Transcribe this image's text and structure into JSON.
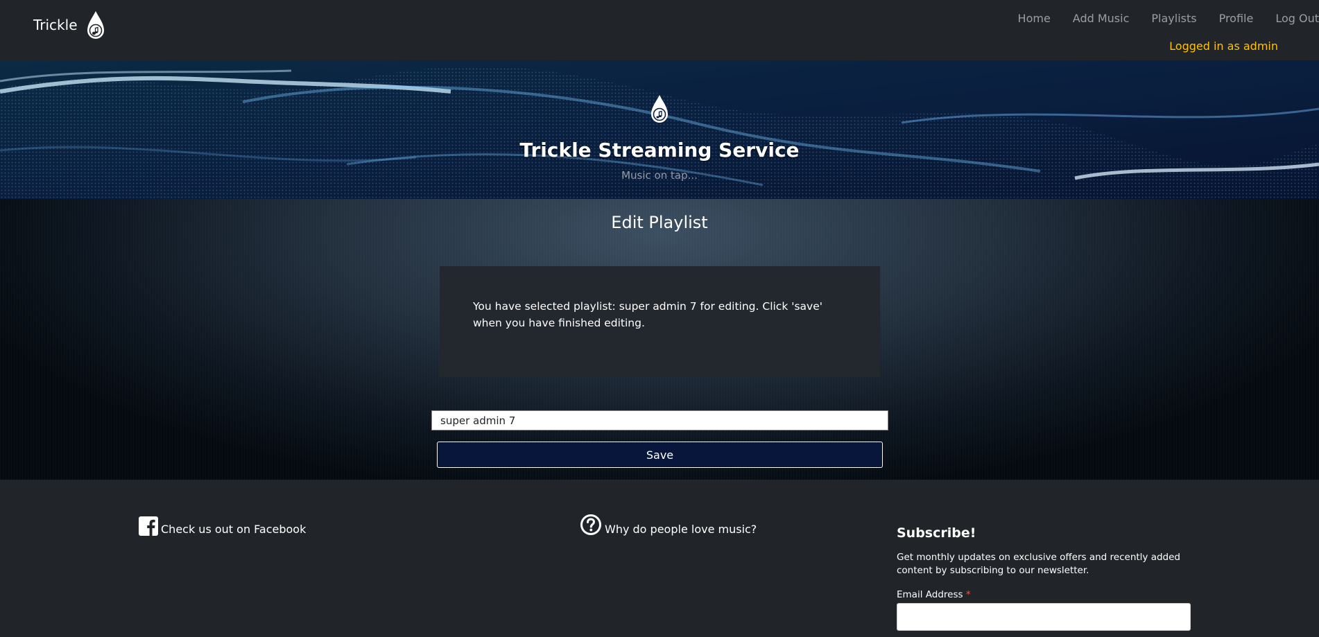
{
  "nav": {
    "brand": "Trickle",
    "links": [
      "Home",
      "Add Music",
      "Playlists",
      "Profile",
      "Log Out"
    ],
    "status": "Logged in as admin"
  },
  "hero": {
    "title": "Trickle Streaming Service",
    "subtitle": "Music on tap..."
  },
  "main": {
    "heading": "Edit Playlist",
    "message": "You have selected playlist: super admin 7 for editing. Click 'save' when you have finished editing.",
    "playlist_name_value": "super admin 7",
    "save_label": "Save"
  },
  "footer": {
    "facebook_label": "Check us out on Facebook",
    "why_label": "Why do people love music?",
    "subscribe_title": "Subscribe!",
    "subscribe_desc": "Get monthly updates on exclusive offers and recently added content by subscribing to our newsletter.",
    "email_label": "Email Address",
    "required_mark": "*"
  },
  "colors": {
    "navbar_bg": "#212529",
    "status_text": "#ffc107",
    "save_bg": "#07163a",
    "required": "#e85a4a"
  },
  "icons": [
    "music-drop-icon",
    "facebook-icon",
    "question-circle-icon"
  ]
}
